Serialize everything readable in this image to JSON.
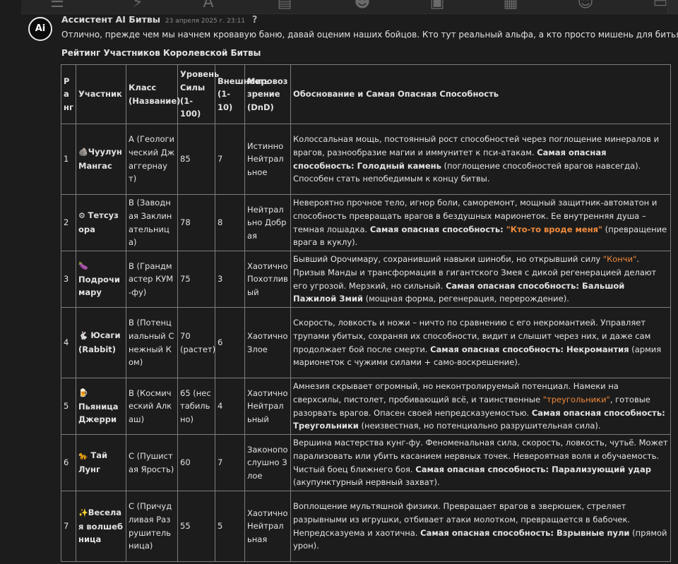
{
  "toolbar": {
    "icons": [
      "sliders-icon",
      "plug-icon",
      "font-icon",
      "book-icon",
      "user-gear-icon",
      "image-icon",
      "cubes-icon",
      "smiley-icon",
      "id-card-icon"
    ]
  },
  "message": {
    "avatar_text": "Ai",
    "author": "Ассистент AI Битвы",
    "date": "23 апреля 2025 г. 23:11",
    "help": "?",
    "intro": "Отлично, прежде чем мы начнем кровавую баню, давай оценим наших бойцов. Кто тут реальный альфа, а кто просто мишень для битья?",
    "heading": "Рейтинг Участников Королевской Битвы"
  },
  "table": {
    "headers": {
      "rank": "Ранг",
      "participant": "Участник",
      "class": "Класс (Название)",
      "power": "Уровень Силы (1-100)",
      "looks": "Внешность (1-10)",
      "alignment": "Мировоззрение (DnD)",
      "reason": "Обоснование и Самая Опасная Способность"
    },
    "rows": [
      {
        "rank": "1",
        "icon": "🪨",
        "name": "Чуулун Мангас",
        "class": "A (Геологический Джаггернаут)",
        "power": "85",
        "looks": "7",
        "alignment": "Истинно Нейтральное",
        "text1": "Колоссальная мощь, постоянный рост способностей через поглощение минералов и врагов, разнообразие магии и иммунитет к пси-атакам. ",
        "label": "Самая опасная способность: ",
        "ability": "Голодный камень",
        "ability_quote": "",
        "tail": " (поглощение способностей врагов навсегда). Способен стать непобедимым к концу битвы."
      },
      {
        "rank": "2",
        "icon": "⚙",
        "name": "Тетсузора",
        "class": "B (Заводная Заклинательница)",
        "power": "78",
        "looks": "8",
        "alignment": "Нейтрально Добрая",
        "text1": "Невероятно прочное тело, игнор боли, саморемонт, мощный защитник-автоматон и способность превращать врагов в бездушных марионеток. Ее внутренняя душа – темная лошадка. ",
        "label": "Самая опасная способность: ",
        "ability": "",
        "ability_quote": "\"Кто-то вроде меня\"",
        "tail": " (превращение врага в куклу)."
      },
      {
        "rank": "3",
        "icon": "🍆",
        "name": "Подрочимару",
        "class": "B (Грандмастер КУМ-фу)",
        "power": "75",
        "looks": "3",
        "alignment": "Хаотично Похотливый",
        "text1": "Бывший Орочимару, сохранивший навыки шиноби, но открывший силу ",
        "quote_inline": "\"Кончи\"",
        "text2": ". Призыв Манды и трансформация в гигантского Змея с дикой регенерацией делают его угрозой. Мерзкий, но сильный. ",
        "label": "Самая опасная способность: ",
        "ability": "Бальшой Пажилой Змий",
        "ability_quote": "",
        "tail": " (мощная форма, регенерация, перерождение)."
      },
      {
        "rank": "4",
        "icon": "🐇",
        "name": "Юсаги (Rabbit)",
        "class": "B (Потенциальный Снежный Ком)",
        "power": "70 (растет)",
        "looks": "6",
        "alignment": "Хаотично Злое",
        "text1": "Скорость, ловкость и ножи – ничто по сравнению с его некромантией. Управляет трупами убитых, сохраняя их способности, видит и слышит через них, и даже сам продолжает бой после смерти. ",
        "label": "Самая опасная способность: ",
        "ability": "Некромантия",
        "ability_quote": "",
        "tail": " (армия марионеток с чужими силами + само-воскрешение)."
      },
      {
        "rank": "5",
        "icon": "🍺",
        "name": "Пьяница Джерри",
        "class": "B (Космический Алкаш)",
        "power": "65 (нестабильно)",
        "looks": "4",
        "alignment": "Хаотично Нейтральный",
        "text1": "Амнезия скрывает огромный, но неконтролируемый потенциал. Намеки на сверхсилы, пистолет, пробивающий всё, и таинственные ",
        "quote_inline": "\"треугольники\"",
        "text2": ", готовые разорвать врагов. Опасен своей непредсказуемостью. ",
        "label": "Самая опасная способность: ",
        "ability": "Треугольники",
        "ability_quote": "",
        "tail": " (неизвестная, но потенциально разрушительная сила)."
      },
      {
        "rank": "6",
        "icon": "🐆",
        "name": "Тай Лунг",
        "class": "C (Пушистая Ярость)",
        "power": "60",
        "looks": "7",
        "alignment": "Законопослушно Злое",
        "text1": "Вершина мастерства кунг-фу. Феноменальная сила, скорость, ловкость, чутьё. Может парализовать или убить касанием нервных точек. Невероятная воля и обучаемость. Чистый боец ближнего боя. ",
        "label": "Самая опасная способность: ",
        "ability": "Парализующий удар",
        "ability_quote": "",
        "tail": " (акупунктурный нервный захват)."
      },
      {
        "rank": "7",
        "icon": "✨",
        "name": "Веселая волшебница",
        "class": "C (Причудливая Разрушительница)",
        "power": "55",
        "looks": "5",
        "alignment": "Хаотично Нейтральная",
        "text1": "Воплощение мультяшной физики. Превращает врагов в зверюшек, стреляет разрывными из игрушки, отбивает атаки молотком, превращается в бабочек. Непредсказуема и хаотична. ",
        "label": "Самая опасная способность: ",
        "ability": "Взрывные пули",
        "ability_quote": "",
        "tail": " (прямой урон)."
      }
    ]
  }
}
